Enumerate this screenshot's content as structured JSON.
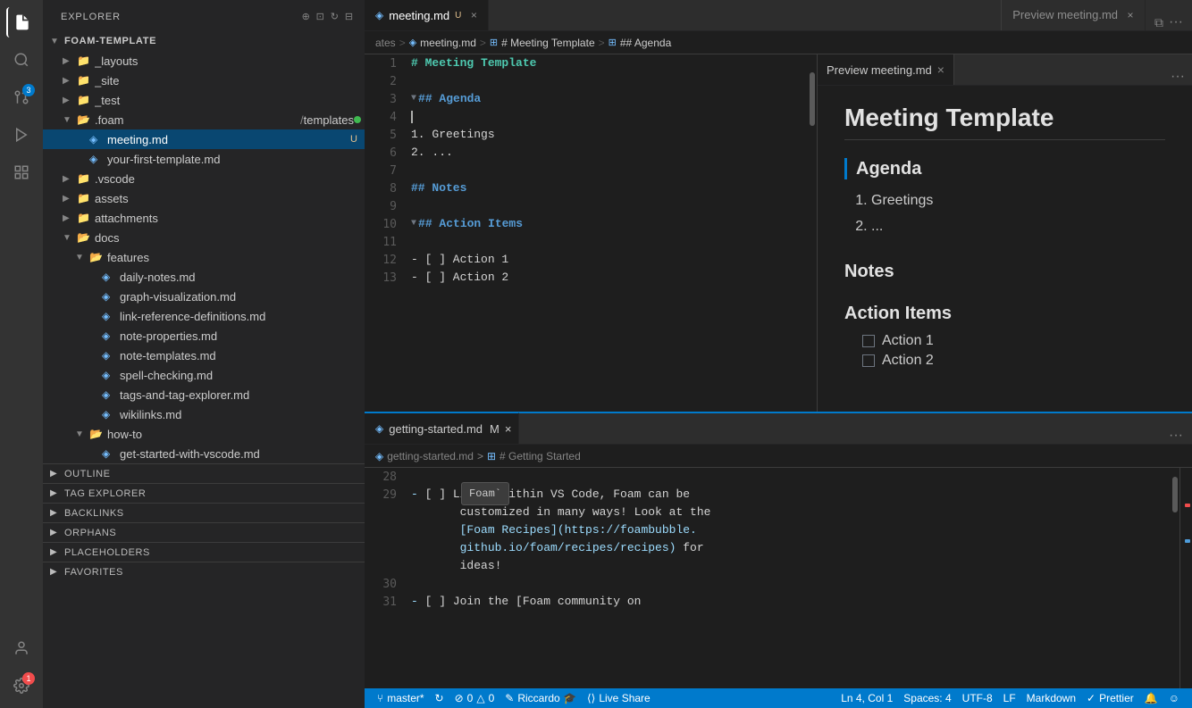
{
  "activityBar": {
    "icons": [
      {
        "name": "files-icon",
        "symbol": "⧉",
        "active": true,
        "badge": null
      },
      {
        "name": "search-icon",
        "symbol": "🔍",
        "active": false,
        "badge": null
      },
      {
        "name": "source-control-icon",
        "symbol": "⑂",
        "active": false,
        "badge": "3"
      },
      {
        "name": "run-icon",
        "symbol": "▷",
        "active": false,
        "badge": null
      },
      {
        "name": "extensions-icon",
        "symbol": "⊞",
        "active": false,
        "badge": null
      }
    ],
    "bottomIcons": [
      {
        "name": "account-icon",
        "symbol": "○"
      },
      {
        "name": "settings-icon",
        "symbol": "⚙"
      }
    ]
  },
  "sidebar": {
    "title": "EXPLORER",
    "rootFolder": "FOAM-TEMPLATE",
    "treeItems": [
      {
        "id": "layouts",
        "label": "_layouts",
        "indent": 1,
        "type": "folder",
        "expanded": false
      },
      {
        "id": "site",
        "label": "_site",
        "indent": 1,
        "type": "folder",
        "expanded": false
      },
      {
        "id": "test",
        "label": "_test",
        "indent": 1,
        "type": "folder",
        "expanded": false
      },
      {
        "id": "foam",
        "label": ".foam / templates",
        "indent": 1,
        "type": "folder",
        "expanded": true,
        "modified": true
      },
      {
        "id": "meeting",
        "label": "meeting.md",
        "indent": 2,
        "type": "foam-file",
        "active": true,
        "modified": "U"
      },
      {
        "id": "your-first",
        "label": "your-first-template.md",
        "indent": 2,
        "type": "foam-file"
      },
      {
        "id": "vscode",
        "label": ".vscode",
        "indent": 1,
        "type": "folder",
        "expanded": false
      },
      {
        "id": "assets",
        "label": "assets",
        "indent": 1,
        "type": "folder",
        "expanded": false
      },
      {
        "id": "attachments",
        "label": "attachments",
        "indent": 1,
        "type": "folder",
        "expanded": false
      },
      {
        "id": "docs",
        "label": "docs",
        "indent": 1,
        "type": "folder",
        "expanded": true
      },
      {
        "id": "features",
        "label": "features",
        "indent": 2,
        "type": "folder",
        "expanded": true
      },
      {
        "id": "daily-notes",
        "label": "daily-notes.md",
        "indent": 3,
        "type": "foam-file"
      },
      {
        "id": "graph-viz",
        "label": "graph-visualization.md",
        "indent": 3,
        "type": "foam-file"
      },
      {
        "id": "link-ref",
        "label": "link-reference-definitions.md",
        "indent": 3,
        "type": "foam-file"
      },
      {
        "id": "note-props",
        "label": "note-properties.md",
        "indent": 3,
        "type": "foam-file"
      },
      {
        "id": "note-tmpl",
        "label": "note-templates.md",
        "indent": 3,
        "type": "foam-file"
      },
      {
        "id": "spell-check",
        "label": "spell-checking.md",
        "indent": 3,
        "type": "foam-file"
      },
      {
        "id": "tags",
        "label": "tags-and-tag-explorer.md",
        "indent": 3,
        "type": "foam-file"
      },
      {
        "id": "wikilinks",
        "label": "wikilinks.md",
        "indent": 3,
        "type": "foam-file"
      },
      {
        "id": "how-to",
        "label": "how-to",
        "indent": 2,
        "type": "folder",
        "expanded": true
      },
      {
        "id": "get-started",
        "label": "get-started-with-vscode.md",
        "indent": 3,
        "type": "foam-file"
      }
    ],
    "sections": [
      {
        "id": "outline",
        "label": "OUTLINE",
        "expanded": false
      },
      {
        "id": "tag-explorer",
        "label": "TAG EXPLORER",
        "expanded": false
      },
      {
        "id": "backlinks",
        "label": "BACKLINKS",
        "expanded": false
      },
      {
        "id": "orphans",
        "label": "ORPHANS",
        "expanded": false
      },
      {
        "id": "placeholders",
        "label": "PLACEHOLDERS",
        "expanded": false
      },
      {
        "id": "favorites",
        "label": "FAVORITES",
        "expanded": false
      }
    ]
  },
  "topEditor": {
    "tabs": [
      {
        "id": "meeting",
        "label": "meeting.md",
        "modified": "U",
        "active": true,
        "icon": "foam"
      },
      {
        "id": "preview",
        "label": "Preview meeting.md",
        "active": false,
        "closable": true
      }
    ],
    "breadcrumb": [
      "ates >",
      "meeting.md",
      ">",
      "# Meeting Template",
      ">",
      "## Agenda"
    ],
    "lines": [
      {
        "num": 1,
        "tokens": [
          {
            "text": "# Meeting Template",
            "class": "syn-h1"
          }
        ]
      },
      {
        "num": 2,
        "tokens": []
      },
      {
        "num": 3,
        "tokens": [
          {
            "text": "## Agenda",
            "class": "syn-h2"
          }
        ],
        "collapsible": true
      },
      {
        "num": 4,
        "tokens": []
      },
      {
        "num": 5,
        "tokens": [
          {
            "text": "1. Greetings",
            "class": "syn-list"
          }
        ]
      },
      {
        "num": 6,
        "tokens": [
          {
            "text": "2. ...",
            "class": "syn-list"
          }
        ]
      },
      {
        "num": 7,
        "tokens": []
      },
      {
        "num": 8,
        "tokens": [
          {
            "text": "## Notes",
            "class": "syn-h2"
          }
        ]
      },
      {
        "num": 9,
        "tokens": []
      },
      {
        "num": 10,
        "tokens": [
          {
            "text": "## Action Items",
            "class": "syn-h2"
          }
        ],
        "collapsible": true
      },
      {
        "num": 11,
        "tokens": []
      },
      {
        "num": 12,
        "tokens": [
          {
            "text": "- [ ] Action 1",
            "class": "syn-list"
          }
        ]
      },
      {
        "num": 13,
        "tokens": [
          {
            "text": "- [ ] Action 2",
            "class": "syn-list"
          }
        ]
      }
    ]
  },
  "bottomEditor": {
    "tabs": [
      {
        "id": "getting-started",
        "label": "getting-started.md",
        "modified": "M",
        "active": true,
        "icon": "foam"
      }
    ],
    "breadcrumb": [
      "getting-started.md",
      ">",
      "# Getting Started"
    ],
    "tooltip": "Foam`",
    "lines": [
      {
        "num": 28,
        "tokens": []
      },
      {
        "num": 29,
        "tokens": [
          {
            "text": "- [ ] Living within VS Code, Foam can be",
            "class": "syn-list"
          },
          {
            "text": "",
            "class": ""
          }
        ]
      },
      {
        "num": "",
        "tokens": [
          {
            "text": "       customized in many ways! Look at the",
            "class": "syn-list"
          }
        ]
      },
      {
        "num": "",
        "tokens": [
          {
            "text": "       [Foam Recipes](https://foambubble.",
            "class": "syn-list"
          }
        ]
      },
      {
        "num": "",
        "tokens": [
          {
            "text": "       github.io/foam/recipes/recipes) for",
            "class": "syn-list"
          }
        ]
      },
      {
        "num": "",
        "tokens": [
          {
            "text": "       ideas!",
            "class": "syn-list"
          }
        ]
      },
      {
        "num": 30,
        "tokens": []
      },
      {
        "num": 31,
        "tokens": [
          {
            "text": "- [ ] Join the [Foam community on",
            "class": "syn-list"
          }
        ]
      }
    ]
  },
  "preview": {
    "title": "Preview meeting.md",
    "content": {
      "heading": "Meeting Template",
      "sections": [
        {
          "title": "Agenda",
          "type": "list-ol",
          "items": [
            "Greetings",
            "..."
          ]
        },
        {
          "title": "Notes",
          "type": "empty"
        },
        {
          "title": "Action Items",
          "type": "list-checkbox",
          "items": [
            "Action 1",
            "Action 2"
          ]
        }
      ]
    }
  },
  "statusBar": {
    "left": [
      {
        "id": "branch",
        "icon": "⑂",
        "label": "master*"
      },
      {
        "id": "sync",
        "icon": "↻",
        "label": ""
      },
      {
        "id": "errors",
        "icon": "⊘",
        "label": "0"
      },
      {
        "id": "warnings",
        "icon": "△",
        "label": "0"
      },
      {
        "id": "user",
        "icon": "✎",
        "label": "Riccardo 🎓"
      },
      {
        "id": "live-share",
        "icon": "⟨⟩",
        "label": "Live Share"
      }
    ],
    "right": [
      {
        "id": "position",
        "label": "Ln 4, Col 1"
      },
      {
        "id": "spaces",
        "label": "Spaces: 4"
      },
      {
        "id": "encoding",
        "label": "UTF-8"
      },
      {
        "id": "eol",
        "label": "LF"
      },
      {
        "id": "language",
        "label": "Markdown"
      },
      {
        "id": "prettier",
        "icon": "✓",
        "label": "Prettier"
      },
      {
        "id": "notifications",
        "icon": "🔔",
        "label": ""
      },
      {
        "id": "feedback",
        "icon": "☺",
        "label": ""
      }
    ]
  }
}
